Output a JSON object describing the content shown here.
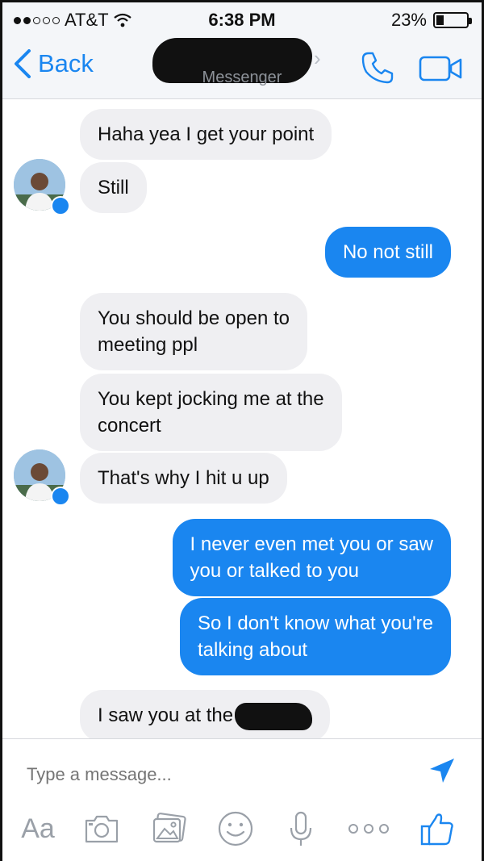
{
  "status": {
    "carrier": "AT&T",
    "time": "6:38 PM",
    "battery": "23%",
    "battery_level": 0.23,
    "signal_bars_filled": 2,
    "signal_bars_total": 5
  },
  "nav": {
    "back_label": "Back",
    "subtitle": "Messenger"
  },
  "messages": [
    {
      "direction": "incoming",
      "text": "Haha yea I get your point"
    },
    {
      "direction": "incoming",
      "text": "Still"
    },
    {
      "direction": "outgoing",
      "text": "No not still"
    },
    {
      "direction": "incoming",
      "text": "You should be open to\nmeeting ppl"
    },
    {
      "direction": "incoming",
      "text": "You kept jocking me at the\nconcert"
    },
    {
      "direction": "incoming",
      "text": "That's why I hit u up"
    },
    {
      "direction": "outgoing",
      "text": "I never even met you or saw\nyou or talked to you"
    },
    {
      "direction": "outgoing",
      "text": "So I don't know what you're\ntalking about"
    },
    {
      "direction": "incoming",
      "text": "I saw you at the"
    }
  ],
  "composer": {
    "placeholder": "Type a message...",
    "aa_label": "Aa"
  },
  "colors": {
    "accent": "#1a86f0",
    "incoming_bubble": "#efeff2",
    "toolbar_icon": "#9aa0a8"
  }
}
